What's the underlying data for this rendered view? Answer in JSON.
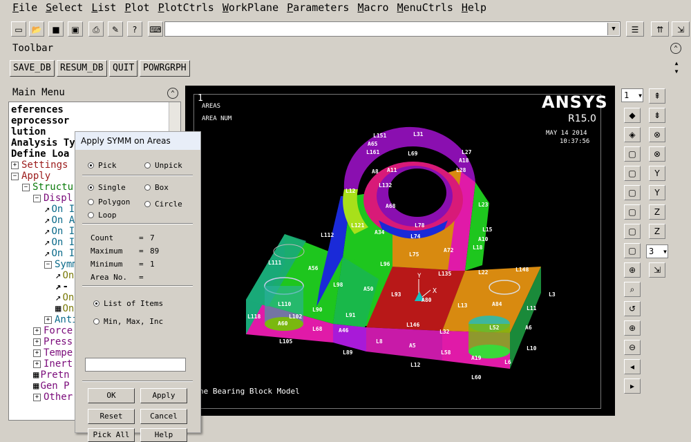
{
  "menubar": [
    "File",
    "Select",
    "List",
    "Plot",
    "PlotCtrls",
    "WorkPlane",
    "Parameters",
    "Macro",
    "MenuCtrls",
    "Help"
  ],
  "toolbar": {
    "label": "Toolbar",
    "buttons": [
      "SAVE_DB",
      "RESUM_DB",
      "QUIT",
      "POWRGRPH"
    ]
  },
  "main_menu": {
    "title": "Main Menu",
    "items": [
      {
        "text": "eferences",
        "style": "b",
        "indent": 0,
        "icon": "none"
      },
      {
        "text": "eprocessor",
        "style": "b",
        "indent": 0,
        "icon": "none"
      },
      {
        "text": "lution",
        "style": "b",
        "indent": 0,
        "icon": "none"
      },
      {
        "text": "Analysis Ty",
        "style": "b",
        "indent": 0,
        "icon": "none"
      },
      {
        "text": "Define Loa",
        "style": "b",
        "indent": 0,
        "icon": "none"
      },
      {
        "text": "Settings",
        "style": "r",
        "indent": 0,
        "icon": "plus"
      },
      {
        "text": "Apply",
        "style": "r",
        "indent": 0,
        "icon": "minus"
      },
      {
        "text": "Structu",
        "style": "g",
        "indent": 1,
        "icon": "minus"
      },
      {
        "text": "Displ",
        "style": "m",
        "indent": 2,
        "icon": "minus"
      },
      {
        "text": "On I",
        "style": "t",
        "indent": 3,
        "icon": "arrow"
      },
      {
        "text": "On A",
        "style": "t",
        "indent": 3,
        "icon": "arrow"
      },
      {
        "text": "On I",
        "style": "t",
        "indent": 3,
        "icon": "arrow"
      },
      {
        "text": "On I",
        "style": "t",
        "indent": 3,
        "icon": "arrow"
      },
      {
        "text": "On I",
        "style": "t",
        "indent": 3,
        "icon": "arrow"
      },
      {
        "text": "Symm",
        "style": "t",
        "indent": 3,
        "icon": "minus"
      },
      {
        "text": "On",
        "style": "y",
        "indent": 4,
        "icon": "arrow"
      },
      {
        "text": "-",
        "style": "b",
        "indent": 4,
        "icon": "arrow"
      },
      {
        "text": "On",
        "style": "y",
        "indent": 4,
        "icon": "arrow"
      },
      {
        "text": "On",
        "style": "y",
        "indent": 4,
        "icon": "grid"
      },
      {
        "text": "Anti",
        "style": "t",
        "indent": 3,
        "icon": "plus"
      },
      {
        "text": "Force",
        "style": "m",
        "indent": 2,
        "icon": "plus"
      },
      {
        "text": "Press",
        "style": "m",
        "indent": 2,
        "icon": "plus"
      },
      {
        "text": "Tempe",
        "style": "m",
        "indent": 2,
        "icon": "plus"
      },
      {
        "text": "Inert",
        "style": "m",
        "indent": 2,
        "icon": "plus"
      },
      {
        "text": "Pretn",
        "style": "m",
        "indent": 2,
        "icon": "grid"
      },
      {
        "text": "Gen P",
        "style": "m",
        "indent": 2,
        "icon": "grid"
      },
      {
        "text": "Other",
        "style": "m",
        "indent": 2,
        "icon": "plus"
      }
    ]
  },
  "graphics": {
    "window_number": "1",
    "label_areas": "AREAS",
    "label_areanum": "AREA NUM",
    "brand": "ANSYS",
    "version": "R15.0",
    "date": "MAY 14 2014",
    "time": "10:37:56",
    "caption": "he Bearing Block Model",
    "triad_x": "X",
    "triad_y": "Y",
    "colors": {
      "magenta": "#e01aa8",
      "green": "#1ec61e",
      "red": "#b81818",
      "purple": "#8a0fb0",
      "orange": "#d88a10",
      "teal": "#19a878",
      "olive": "#7ab80f",
      "blue": "#1a2ad8",
      "lime": "#a8e01a",
      "pink": "#d81a78",
      "darkgreen": "#1a8a3a",
      "cyan": "#18c0c0"
    }
  },
  "right_panel": {
    "window_select": "1",
    "view_select": "3"
  },
  "dialog": {
    "title": "Apply SYMM on Areas",
    "pick": "Pick",
    "unpick": "Unpick",
    "single": "Single",
    "box": "Box",
    "polygon": "Polygon",
    "circle": "Circle",
    "loop": "Loop",
    "count_label": "Count",
    "count_value": "7",
    "max_label": "Maximum",
    "max_value": "89",
    "min_label": "Minimum",
    "min_value": "1",
    "areano_label": "Area No.",
    "list_items": "List of Items",
    "min_max_inc": "Min, Max, Inc",
    "ok": "OK",
    "apply": "Apply",
    "reset": "Reset",
    "cancel": "Cancel",
    "pick_all": "Pick All",
    "help": "Help"
  },
  "model_labels": [
    {
      "t": "L151"
    },
    {
      "t": "L31"
    },
    {
      "t": "A65"
    },
    {
      "t": "L69"
    },
    {
      "t": "L27"
    },
    {
      "t": "L161"
    },
    {
      "t": "A18"
    },
    {
      "t": "L28"
    },
    {
      "t": "A8"
    },
    {
      "t": "A11"
    },
    {
      "t": "L12"
    },
    {
      "t": "L132"
    },
    {
      "t": "A68"
    },
    {
      "t": "L23"
    },
    {
      "t": "L112"
    },
    {
      "t": "L121"
    },
    {
      "t": "A34"
    },
    {
      "t": "L78"
    },
    {
      "t": "L74"
    },
    {
      "t": "A72"
    },
    {
      "t": "L15"
    },
    {
      "t": "A10"
    },
    {
      "t": "L18"
    },
    {
      "t": "L111"
    },
    {
      "t": "A56"
    },
    {
      "t": "L96"
    },
    {
      "t": "L75"
    },
    {
      "t": "L135"
    },
    {
      "t": "L22"
    },
    {
      "t": "L148"
    },
    {
      "t": "L98"
    },
    {
      "t": "A50"
    },
    {
      "t": "L93"
    },
    {
      "t": "A80"
    },
    {
      "t": "L3"
    },
    {
      "t": "L110"
    },
    {
      "t": "L13"
    },
    {
      "t": "A84"
    },
    {
      "t": "L11"
    },
    {
      "t": "L118"
    },
    {
      "t": "L90"
    },
    {
      "t": "L91"
    },
    {
      "t": "L146"
    },
    {
      "t": "A6"
    },
    {
      "t": "A60"
    },
    {
      "t": "L68"
    },
    {
      "t": "A46"
    },
    {
      "t": "L32"
    },
    {
      "t": "L105"
    },
    {
      "t": "L8"
    },
    {
      "t": "A5"
    },
    {
      "t": "L10"
    },
    {
      "t": "L89"
    },
    {
      "t": "L58"
    },
    {
      "t": "A19"
    },
    {
      "t": "L12"
    },
    {
      "t": "L6"
    },
    {
      "t": "L60"
    },
    {
      "t": "L52"
    },
    {
      "t": "L102"
    }
  ]
}
